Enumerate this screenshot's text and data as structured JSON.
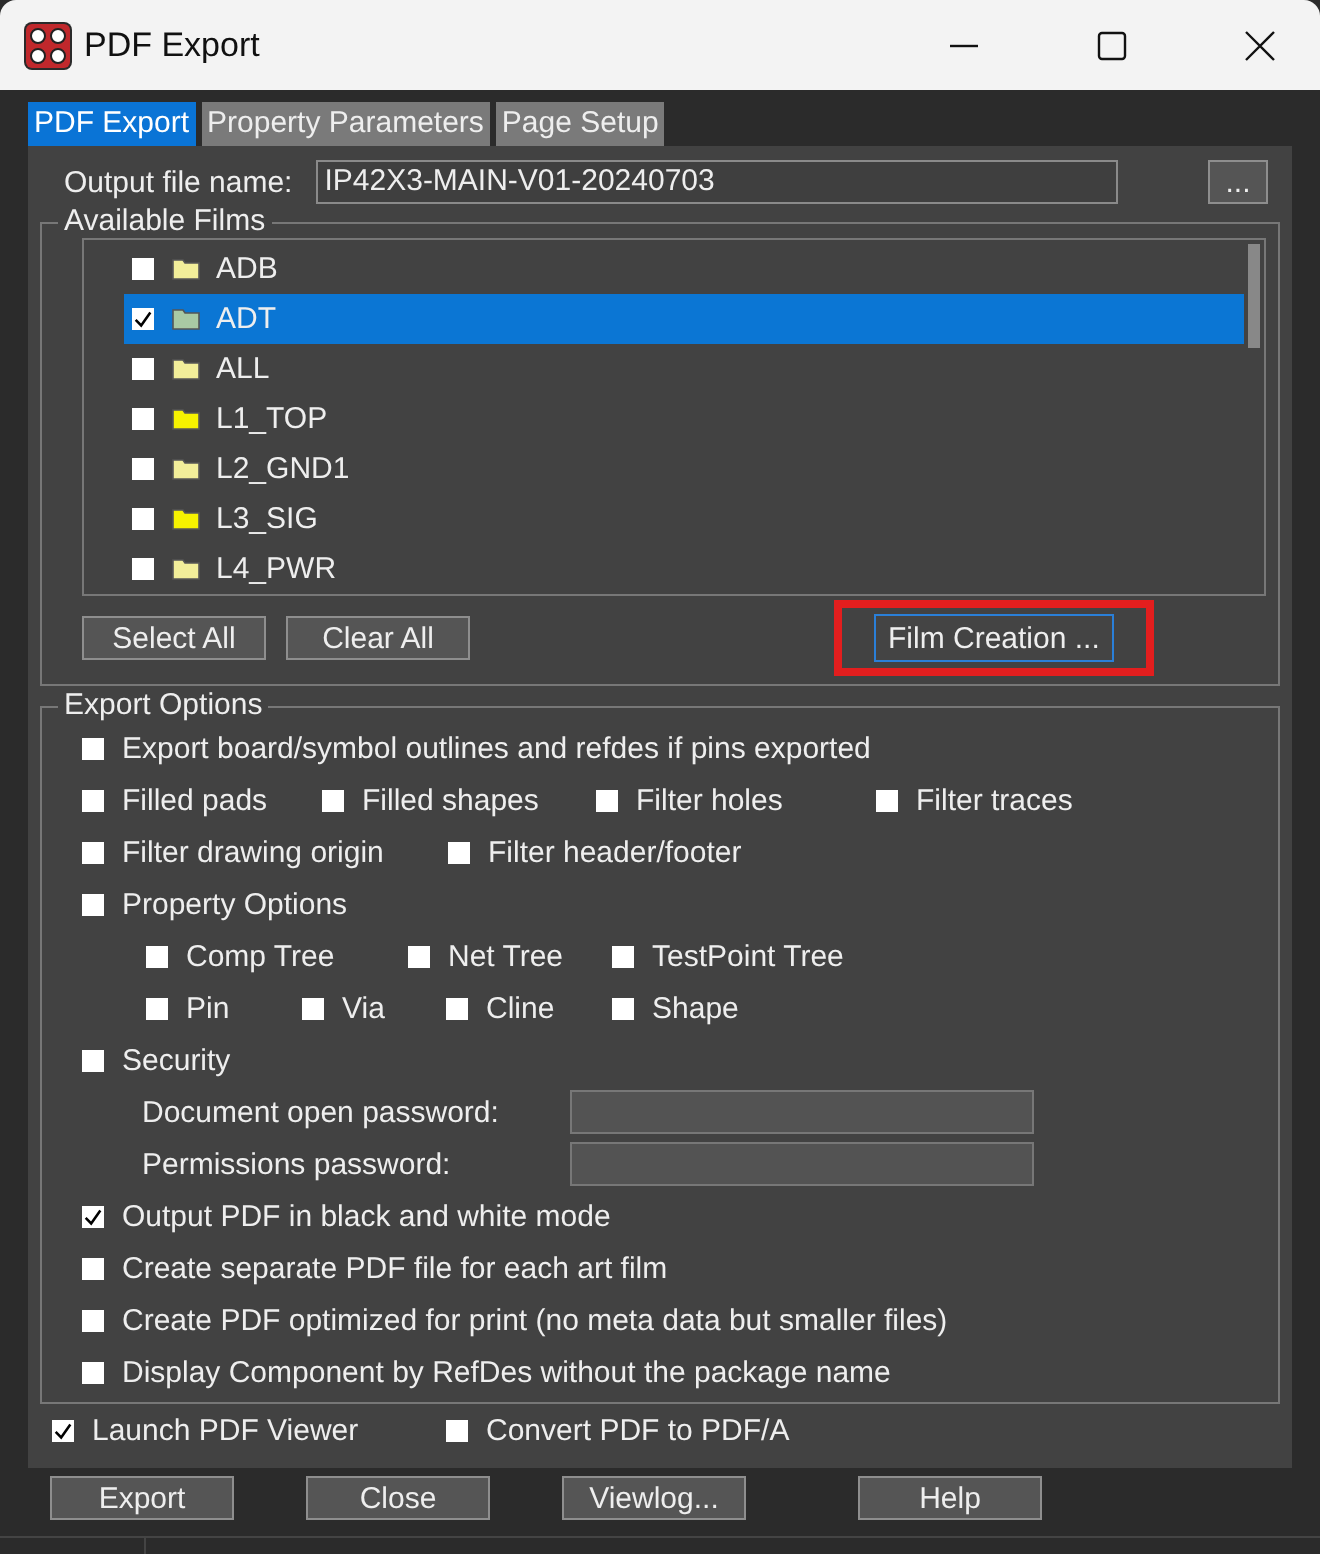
{
  "window": {
    "title": "PDF Export"
  },
  "tabs": [
    {
      "label": "PDF Export",
      "selected": true
    },
    {
      "label": "Property Parameters",
      "selected": false
    },
    {
      "label": "Page Setup",
      "selected": false
    }
  ],
  "output_file": {
    "label": "Output file name:",
    "value": "IP42X3-MAIN-V01-20240703",
    "browse": "..."
  },
  "films": {
    "title": "Available Films",
    "items": [
      {
        "name": "ADB",
        "checked": false,
        "selected": false,
        "color": "#f2ee9a"
      },
      {
        "name": "ADT",
        "checked": true,
        "selected": true,
        "color": "#a9c9a4"
      },
      {
        "name": "ALL",
        "checked": false,
        "selected": false,
        "color": "#f2ee9a"
      },
      {
        "name": "L1_TOP",
        "checked": false,
        "selected": false,
        "color": "#f6f200"
      },
      {
        "name": "L2_GND1",
        "checked": false,
        "selected": false,
        "color": "#f2ee9a"
      },
      {
        "name": "L3_SIG",
        "checked": false,
        "selected": false,
        "color": "#f6f200"
      },
      {
        "name": "L4_PWR",
        "checked": false,
        "selected": false,
        "color": "#f2ee9a"
      }
    ],
    "buttons": [
      "Select All",
      "Clear All"
    ],
    "film_creation": "Film Creation ..."
  },
  "export_options": {
    "title": "Export Options",
    "rows": [
      {
        "kind": "check",
        "items": [
          {
            "label": "Export board/symbol outlines and refdes if pins exported",
            "checked": false
          }
        ]
      },
      {
        "kind": "check",
        "items": [
          {
            "label": "Filled pads",
            "checked": false
          },
          {
            "label": "Filled shapes",
            "checked": false
          },
          {
            "label": "Filter holes",
            "checked": false
          },
          {
            "label": "Filter traces",
            "checked": false
          }
        ]
      },
      {
        "kind": "check",
        "items": [
          {
            "label": "Filter drawing origin",
            "checked": false
          },
          {
            "label": "Filter header/footer",
            "checked": false
          }
        ]
      },
      {
        "kind": "check",
        "items": [
          {
            "label": "Property Options",
            "checked": false
          }
        ]
      },
      {
        "kind": "subcheck",
        "items": [
          {
            "label": "Comp Tree",
            "checked": false
          },
          {
            "label": "Net Tree",
            "checked": false
          },
          {
            "label": "TestPoint Tree",
            "checked": false
          }
        ]
      },
      {
        "kind": "subcheck",
        "items": [
          {
            "label": "Pin",
            "checked": false
          },
          {
            "label": "Via",
            "checked": false
          },
          {
            "label": "Cline",
            "checked": false
          },
          {
            "label": "Shape",
            "checked": false
          }
        ]
      },
      {
        "kind": "check",
        "items": [
          {
            "label": "Security",
            "checked": false
          }
        ]
      },
      {
        "kind": "field",
        "label": "Document open password:"
      },
      {
        "kind": "field",
        "label": "Permissions password:"
      },
      {
        "kind": "check",
        "items": [
          {
            "label": "Output PDF in black and white mode",
            "checked": true
          }
        ]
      },
      {
        "kind": "check",
        "items": [
          {
            "label": "Create separate PDF file for each art film",
            "checked": false
          }
        ]
      },
      {
        "kind": "check",
        "items": [
          {
            "label": "Create PDF optimized for print (no meta data but smaller files)",
            "checked": false
          }
        ]
      },
      {
        "kind": "check",
        "items": [
          {
            "label": "Display Component by RefDes without the package name",
            "checked": false
          }
        ]
      }
    ]
  },
  "bottom_options": [
    {
      "label": "Launch PDF Viewer",
      "checked": true
    },
    {
      "label": "Convert PDF to PDF/A",
      "checked": false
    }
  ],
  "buttons": [
    "Export",
    "Close",
    "Viewlog...",
    "Help"
  ]
}
